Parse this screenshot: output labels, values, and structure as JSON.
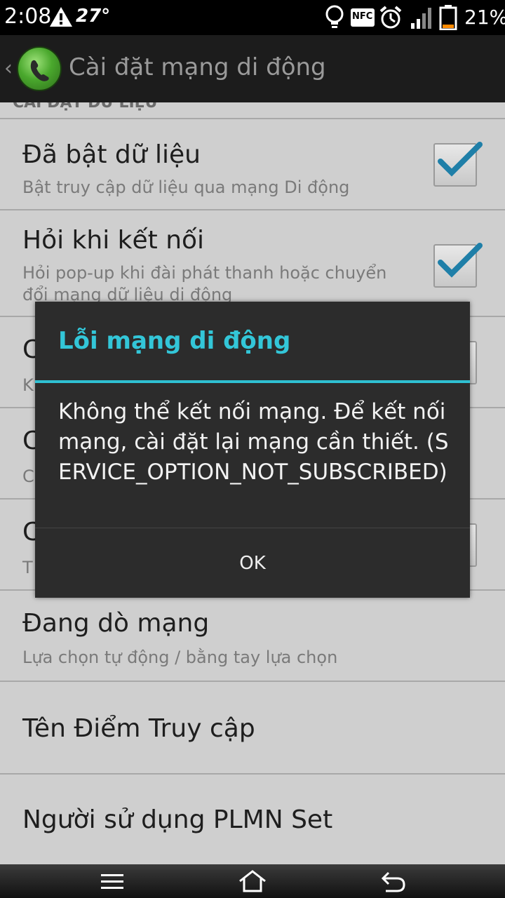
{
  "status_bar": {
    "time": "2:08",
    "temperature": "27°",
    "battery_percent": "21%",
    "icons": [
      "warning-icon",
      "lightbulb-icon",
      "nfc-icon",
      "alarm-icon",
      "signal-icon",
      "battery-icon"
    ],
    "nfc_label": "NFC",
    "battery_level": 0.21
  },
  "action_bar": {
    "back_glyph": "‹",
    "title": "Cài đặt mạng di động",
    "app_icon": "phone-app-icon"
  },
  "list": {
    "section_header": "CÀI ĐẶT DỮ LIỆU",
    "items": [
      {
        "title": "Đã bật dữ liệu",
        "summary": "Bật truy cập dữ liệu qua mạng Di động",
        "checked": true
      },
      {
        "title": "Hỏi khi kết nối",
        "summary": "Hỏi pop-up khi đài phát thanh hoặc chuyển đổi mạng dữ liệu di động",
        "checked": true
      },
      {
        "title": "C",
        "summary": "K"
      },
      {
        "title": "C",
        "summary": "C"
      },
      {
        "title": "C",
        "summary": "T"
      },
      {
        "title": "Đang dò mạng",
        "summary": "Lựa chọn tự động / bằng tay lựa chọn"
      },
      {
        "title": "Tên Điểm Truy cập"
      },
      {
        "title": "Người sử dụng PLMN Set"
      }
    ]
  },
  "dialog": {
    "title": "Lỗi mạng di động",
    "message": "Không thể kết nối mạng. Để kết nối mạng, cài đặt lại mạng cần thiết. (SERVICE_OPTION_NOT_SUBSCRIBED)",
    "ok_label": "OK"
  },
  "nav_bar": {
    "buttons": [
      "menu-icon",
      "home-icon",
      "back-icon"
    ]
  },
  "colors": {
    "accent": "#33c6d8",
    "checkmark": "#1f7fa8",
    "status_bar": "#000000",
    "action_bar": "#1c1c1c",
    "dialog_bg": "#2c2c2c",
    "list_bg": "#cfcfcf"
  }
}
